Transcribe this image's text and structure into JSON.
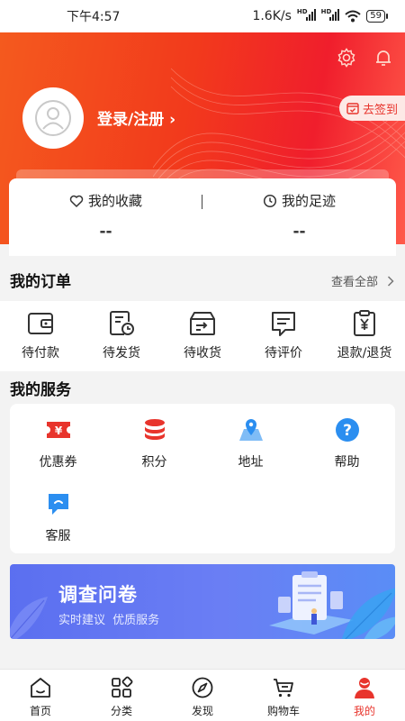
{
  "status_bar": {
    "time": "下午4:57",
    "speed": "1.6K/s",
    "battery": "59"
  },
  "header": {
    "login_label": "登录/注册",
    "checkin_label": "去签到"
  },
  "favorites": {
    "favorites_label": "我的收藏",
    "favorites_value": "--",
    "footprints_label": "我的足迹",
    "footprints_value": "--"
  },
  "orders": {
    "title": "我的订单",
    "view_all": "查看全部",
    "items": [
      {
        "label": "待付款",
        "icon": "wallet-icon"
      },
      {
        "label": "待发货",
        "icon": "pending-ship-icon"
      },
      {
        "label": "待收货",
        "icon": "delivery-box-icon"
      },
      {
        "label": "待评价",
        "icon": "review-icon"
      },
      {
        "label": "退款/退货",
        "icon": "refund-icon"
      }
    ]
  },
  "services": {
    "title": "我的服务",
    "items": [
      {
        "label": "优惠券",
        "icon": "coupon-icon",
        "color": "#e8342c"
      },
      {
        "label": "积分",
        "icon": "points-icon",
        "color": "#e8342c"
      },
      {
        "label": "地址",
        "icon": "location-icon",
        "color": "#2b8ef0"
      },
      {
        "label": "帮助",
        "icon": "help-icon",
        "color": "#2b8ef0"
      },
      {
        "label": "客服",
        "icon": "chat-icon",
        "color": "#2b8ef0"
      }
    ]
  },
  "banner": {
    "title": "调查问卷",
    "subtitle": "实时建议  优质服务"
  },
  "bottom_nav": {
    "items": [
      {
        "label": "首页",
        "icon": "home-icon"
      },
      {
        "label": "分类",
        "icon": "category-icon"
      },
      {
        "label": "发现",
        "icon": "compass-icon"
      },
      {
        "label": "购物车",
        "icon": "cart-icon"
      },
      {
        "label": "我的",
        "icon": "profile-icon"
      }
    ],
    "active_index": 4
  },
  "colors": {
    "accent": "#e8342c",
    "blue": "#2b8ef0",
    "banner": "#5b6ff0"
  }
}
